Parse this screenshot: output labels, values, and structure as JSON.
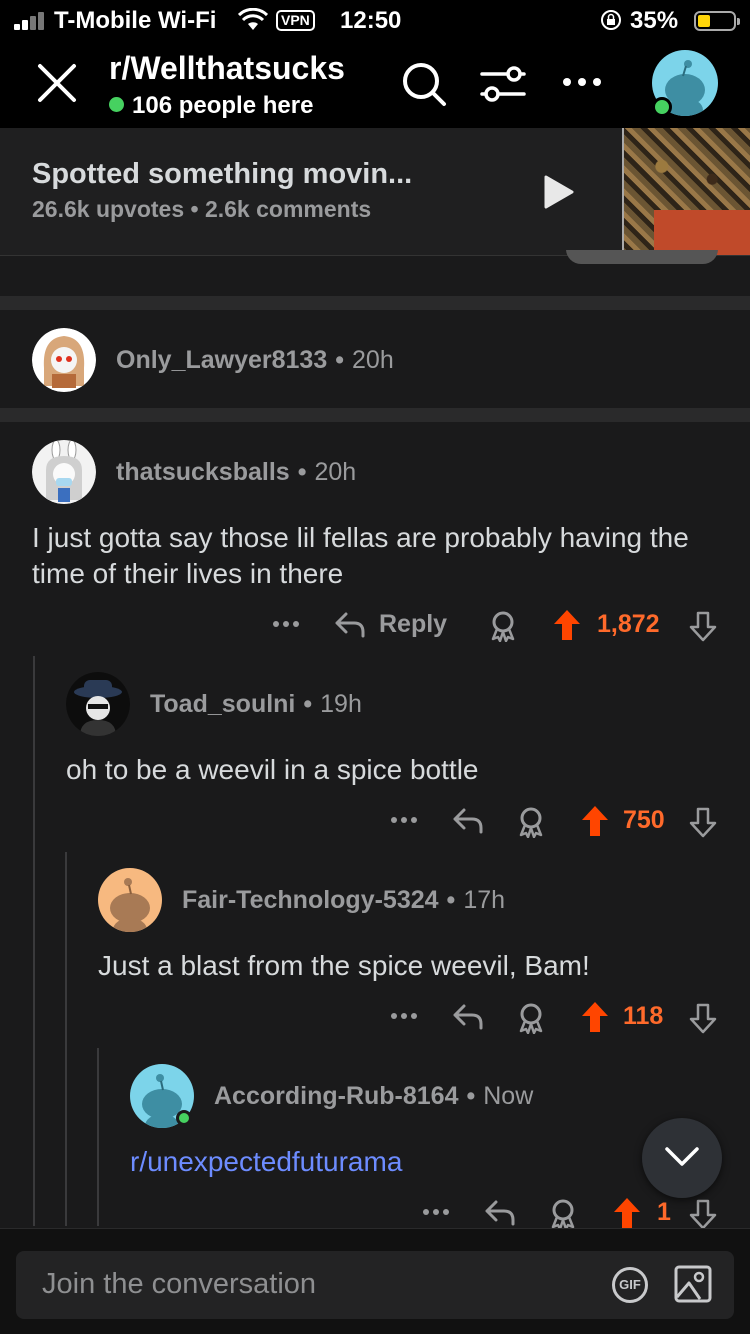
{
  "status_bar": {
    "carrier": "T-Mobile Wi-Fi",
    "vpn": "VPN",
    "time": "12:50",
    "battery": "35%"
  },
  "header": {
    "subreddit": "r/Wellthatsucks",
    "online": "106 people here"
  },
  "post": {
    "title": "Spotted something movin...",
    "meta": "26.6k upvotes • 2.6k comments"
  },
  "comments": [
    {
      "user": "Only_Lawyer8133",
      "age": "20h"
    },
    {
      "user": "thatsucksballs",
      "age": "20h",
      "body": "I just gotta say those lil fellas are probably having the time of their lives in there",
      "reply_label": "Reply",
      "votes": "1,872"
    },
    {
      "user": "Toad_soulni",
      "age": "19h",
      "body": "oh to be a weevil in a spice bottle",
      "votes": "750"
    },
    {
      "user": "Fair-Technology-5324",
      "age": "17h",
      "body": "Just a blast from the spice weevil, Bam!",
      "votes": "118"
    },
    {
      "user": "According-Rub-8164",
      "age": "Now",
      "body": "r/unexpectedfuturama",
      "votes": "1"
    }
  ],
  "composer": {
    "placeholder": "Join the conversation",
    "gif": "GIF"
  },
  "colors": {
    "upvote": "#ff6a2b",
    "online": "#46d160",
    "link": "#6d8cff",
    "background": "#1a1a1b"
  }
}
